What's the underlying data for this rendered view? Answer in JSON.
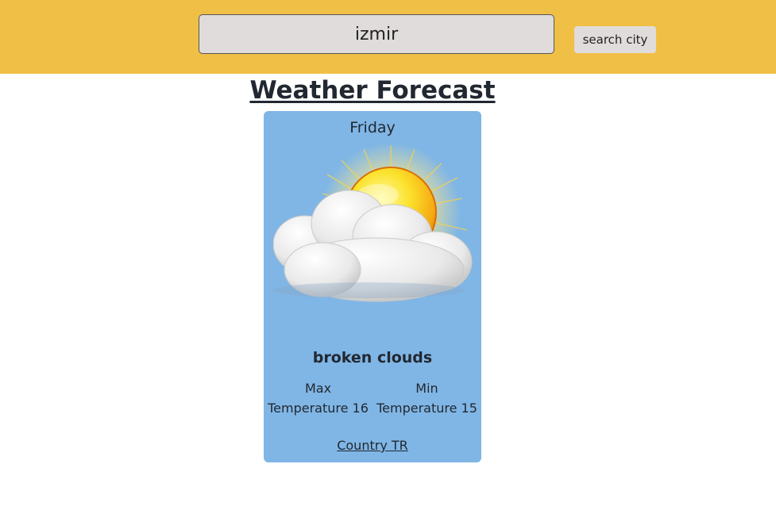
{
  "search": {
    "value": "izmir",
    "button_label": "search city"
  },
  "page": {
    "title": "Weather Forecast"
  },
  "forecast": {
    "day": "Friday",
    "icon": "sun-behind-clouds-icon",
    "description": "broken clouds",
    "max_label": "Max",
    "max_value_text": "Temperature 16",
    "min_label": "Min",
    "min_value_text": "Temperature 15",
    "country_text": "Country TR"
  },
  "colors": {
    "header": "#f0bf46",
    "card": "#80b6e5",
    "input_bg": "#e0dcdb"
  }
}
